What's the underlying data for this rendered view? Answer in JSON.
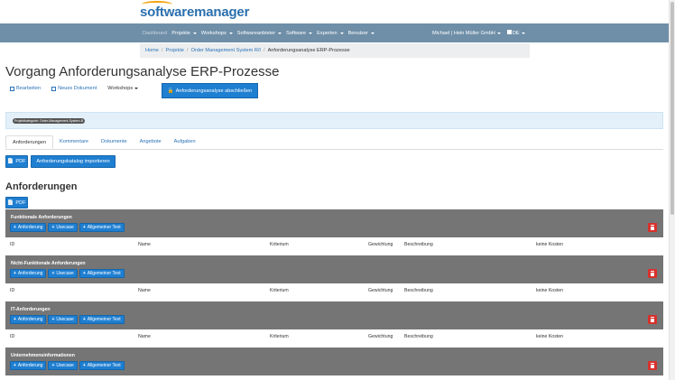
{
  "logo": {
    "text": "softwaremanager"
  },
  "nav": {
    "items": [
      {
        "label": "Dashboard",
        "caret": false
      },
      {
        "label": "Projekte",
        "caret": true
      },
      {
        "label": "Workshops",
        "caret": true
      },
      {
        "label": "Softwareanbieter",
        "caret": true
      },
      {
        "label": "Software",
        "caret": true
      },
      {
        "label": "Experten",
        "caret": true
      },
      {
        "label": "Benutzer",
        "caret": true
      }
    ],
    "user": "Michael | Hein Müller GmbH",
    "lang": "DE"
  },
  "breadcrumb": [
    "Home",
    "Projekte",
    "Order Management System R/I",
    "Anforderungsanalyse ERP-Prozesse"
  ],
  "page_title": "Vorgang Anforderungsanalyse ERP-Prozesse",
  "actions": {
    "edit": "Bearbeiten",
    "new_doc": "Neues Dokument",
    "workshops": "Workshops",
    "finish": "Anforderungsanalyse abschließen"
  },
  "info": {
    "badge": "Projektkategorie: Order-Management-System-B"
  },
  "tabs": [
    "Anforderungen",
    "Kommentare",
    "Dokumente",
    "Angebote",
    "Aufgaben"
  ],
  "toolbar": {
    "pdf": "PDF",
    "import": "Anforderungskatalog importieren"
  },
  "section": {
    "title": "Anforderungen",
    "pdf": "PDF"
  },
  "group_buttons": [
    "Anforderung",
    "Usecase",
    "Allgemeiner Text"
  ],
  "groups": [
    {
      "title": "Funktionale Anforderungen"
    },
    {
      "title": "Nicht-Funktionale Anforderungen"
    },
    {
      "title": "IT-Anforderungen"
    },
    {
      "title": "Unternehmensinformationen"
    }
  ],
  "columns": [
    "ID",
    "Name",
    "Kriterium",
    "Gewichtung",
    "Beschreibung",
    "keine Kosten"
  ],
  "colors": {
    "navbar": "#6f8fa8",
    "primary": "#1f7fd1",
    "group": "#757575",
    "danger": "#d9302c",
    "info": "#e4f0f9"
  }
}
